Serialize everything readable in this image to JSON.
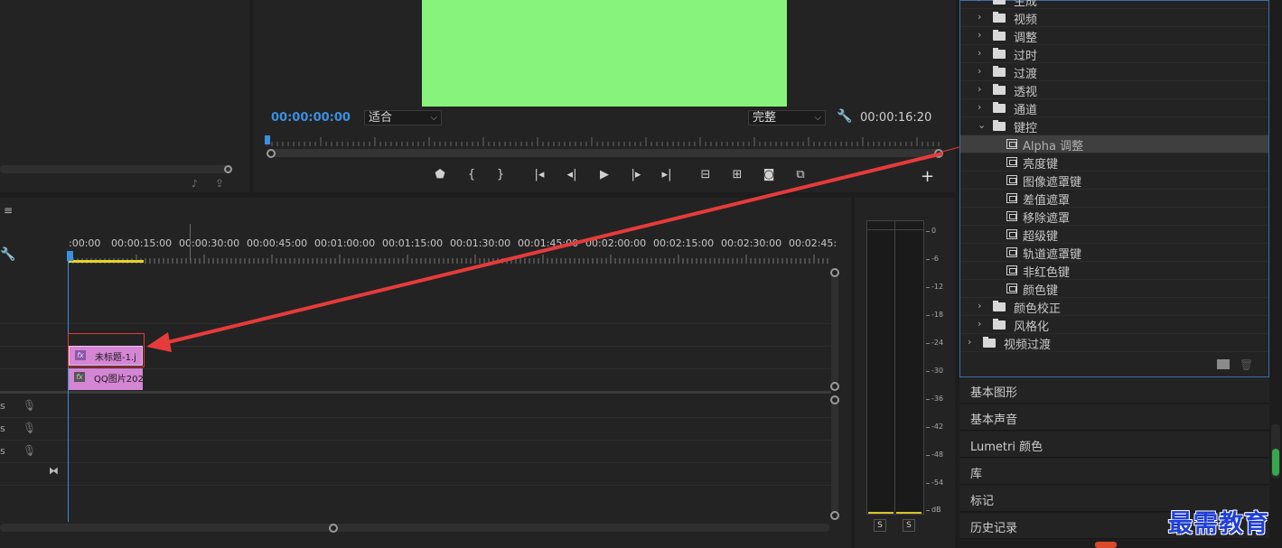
{
  "program_monitor": {
    "timecode_current": "00:00:00:00",
    "timecode_duration": "00:00:16:20",
    "zoom_select": "适合",
    "resolution_select": "完整",
    "frame_color": "#87f37c"
  },
  "transport": {
    "marker": "marker-icon",
    "in": "{",
    "out": "}",
    "go_in": "{←",
    "step_back": "◂|",
    "play": "▶",
    "step_fwd": "|▸",
    "go_out": "→}",
    "lift": "lift-icon",
    "extract": "extract-icon",
    "export_frame": "camera-icon",
    "compare": "compare-icon",
    "add": "+"
  },
  "timeline": {
    "menu_glyph": "≡",
    "ruler": [
      ":00:00",
      "00:00:15:00",
      "00:00:30:00",
      "00:00:45:00",
      "00:01:00:00",
      "00:01:15:00",
      "00:01:30:00",
      "00:01:45:00",
      "00:02:00:00",
      "00:02:15:00",
      "00:02:30:00",
      "00:02:45:"
    ],
    "audio_track_suffix": [
      "s",
      "s",
      "s"
    ],
    "clips": [
      {
        "fx": "fx",
        "name": "未标题-1.j"
      },
      {
        "fx": "fx",
        "name": "QQ图片202"
      }
    ]
  },
  "audio_meter": {
    "scale": [
      "0",
      "-6",
      "-12",
      "-18",
      "-24",
      "-30",
      "-36",
      "-42",
      "-48",
      "-54",
      "dB"
    ],
    "solo_buttons": [
      "S",
      "S"
    ]
  },
  "effects": {
    "items": [
      {
        "type": "folder",
        "depth": 1,
        "label": "生成",
        "expanded": false
      },
      {
        "type": "folder",
        "depth": 1,
        "label": "视频",
        "expanded": false
      },
      {
        "type": "folder",
        "depth": 1,
        "label": "调整",
        "expanded": false
      },
      {
        "type": "folder",
        "depth": 1,
        "label": "过时",
        "expanded": false
      },
      {
        "type": "folder",
        "depth": 1,
        "label": "过渡",
        "expanded": false
      },
      {
        "type": "folder",
        "depth": 1,
        "label": "透视",
        "expanded": false
      },
      {
        "type": "folder",
        "depth": 1,
        "label": "通道",
        "expanded": false
      },
      {
        "type": "folder",
        "depth": 1,
        "label": "键控",
        "expanded": true
      },
      {
        "type": "effect",
        "depth": 2,
        "label": "Alpha 调整",
        "selected": true
      },
      {
        "type": "effect",
        "depth": 2,
        "label": "亮度键"
      },
      {
        "type": "effect",
        "depth": 2,
        "label": "图像遮罩键"
      },
      {
        "type": "effect",
        "depth": 2,
        "label": "差值遮罩"
      },
      {
        "type": "effect",
        "depth": 2,
        "label": "移除遮罩"
      },
      {
        "type": "effect",
        "depth": 2,
        "label": "超级键"
      },
      {
        "type": "effect",
        "depth": 2,
        "label": "轨道遮罩键"
      },
      {
        "type": "effect",
        "depth": 2,
        "label": "非红色键"
      },
      {
        "type": "effect",
        "depth": 2,
        "label": "颜色键"
      },
      {
        "type": "folder",
        "depth": 1,
        "label": "颜色校正",
        "expanded": false
      },
      {
        "type": "folder",
        "depth": 1,
        "label": "风格化",
        "expanded": false
      },
      {
        "type": "folder",
        "depth": 0,
        "label": "视频过渡",
        "expanded": false
      }
    ]
  },
  "collapsed_panels": [
    "基本图形",
    "基本声音",
    "Lumetri 颜色",
    "库",
    "标记",
    "历史记录"
  ],
  "watermark": "最需教育",
  "colors": {
    "accent_blue": "#3b8fe0",
    "clip_pink": "#d485d4",
    "annotation_red": "#e03a3a",
    "panel_focus": "#3f6da8"
  }
}
